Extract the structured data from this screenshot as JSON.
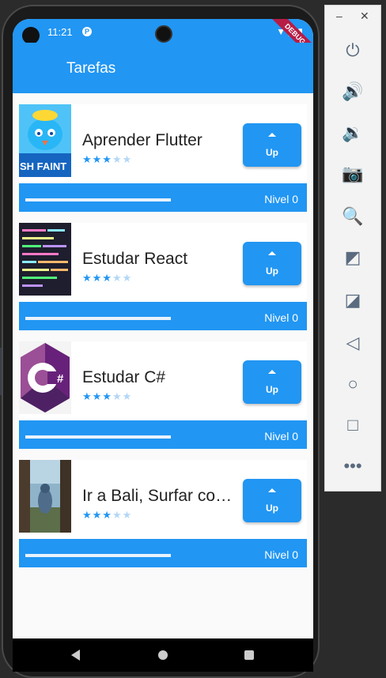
{
  "status_bar": {
    "time": "11:21",
    "p_glyph": "P",
    "icons": "▼◢▮",
    "debug_label": "DEBUG"
  },
  "app_bar": {
    "title": "Tarefas"
  },
  "tasks": [
    {
      "name": "Aprender Flutter",
      "stars_on": "★★★",
      "stars_off": "★★",
      "up_label": "Up",
      "level_label": "Nivel 0",
      "progress": 0,
      "thumb": "flutter-bird-thumbnail",
      "thumb_text": "SH FAINT"
    },
    {
      "name": "Estudar React",
      "stars_on": "★★★",
      "stars_off": "★★",
      "up_label": "Up",
      "level_label": "Nivel 0",
      "progress": 0,
      "thumb": "code-editor-thumbnail"
    },
    {
      "name": "Estudar C#",
      "stars_on": "★★★",
      "stars_off": "★★",
      "up_label": "Up",
      "level_label": "Nivel 0",
      "progress": 0,
      "thumb": "csharp-logo-thumbnail",
      "thumb_text": "#"
    },
    {
      "name": "Ir a Bali, Surfar com os amigos",
      "stars_on": "★★★",
      "stars_off": "★★",
      "up_label": "Up",
      "level_label": "Nivel 0",
      "progress": 0,
      "thumb": "bali-landscape-thumbnail"
    }
  ],
  "emulator_panel": {
    "minimize": "–",
    "close": "✕",
    "controls": [
      "power-icon",
      "volume-up-icon",
      "volume-down-icon",
      "camera-icon",
      "zoom-icon",
      "rotate-left-icon",
      "rotate-right-icon",
      "back-icon",
      "home-icon",
      "overview-icon",
      "more-icon"
    ],
    "glyphs": [
      "⏻",
      "🔊",
      "🔉",
      "📷",
      "🔍",
      "◩",
      "◪",
      "◁",
      "○",
      "□",
      "•••"
    ]
  },
  "colors": {
    "primary": "#2196f3",
    "star_off": "#b3d7f7",
    "debug": "#b71c45"
  }
}
